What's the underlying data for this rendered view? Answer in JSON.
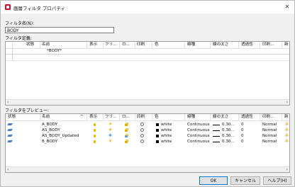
{
  "window": {
    "title": "画層フィルタ プロパティ"
  },
  "filter_name_label": "フィルタ名(N):",
  "filter_name_value": "BODY",
  "filter_def_label": "フィルタ定義:",
  "def_headers": [
    "状態",
    "名前",
    "表示",
    "フリ...",
    "ロ...",
    "印刷",
    "色",
    "線種",
    "線の太さ",
    "透過性",
    "印刷...",
    "新"
  ],
  "def_row": {
    "name": "*BODY*"
  },
  "preview_label": "フィルタをプレビュー:",
  "prev_headers": [
    "状態",
    "名前",
    "表示",
    "フリ...",
    "ロ...",
    "印刷",
    "色",
    "線種",
    "線の太さ",
    "透過性",
    "印刷...",
    "新"
  ],
  "layers": [
    {
      "name": "A_BODY",
      "color": "white",
      "linetype": "Continuous",
      "lineweight": "0.30...",
      "transparency": "0",
      "plotstyle": "Normal"
    },
    {
      "name": "AS_BODY",
      "color": "white",
      "linetype": "Continuous",
      "lineweight": "0.30...",
      "transparency": "0",
      "plotstyle": "Normal"
    },
    {
      "name": "AS_BODY_Updated",
      "color": "white",
      "linetype": "Continuous",
      "lineweight": "0.30...",
      "transparency": "0",
      "plotstyle": "Normal"
    },
    {
      "name": "B_BODY",
      "color": "white",
      "linetype": "Continuous",
      "lineweight": "0.30...",
      "transparency": "0",
      "plotstyle": "Normal"
    }
  ],
  "buttons": {
    "ok": "OK",
    "cancel": "キャンセル",
    "help": "ヘルプ(H)"
  },
  "colors": {
    "accent": "#0078d7",
    "icon_yellow": "#f0b400",
    "state_blue": "#4a7fc1"
  }
}
